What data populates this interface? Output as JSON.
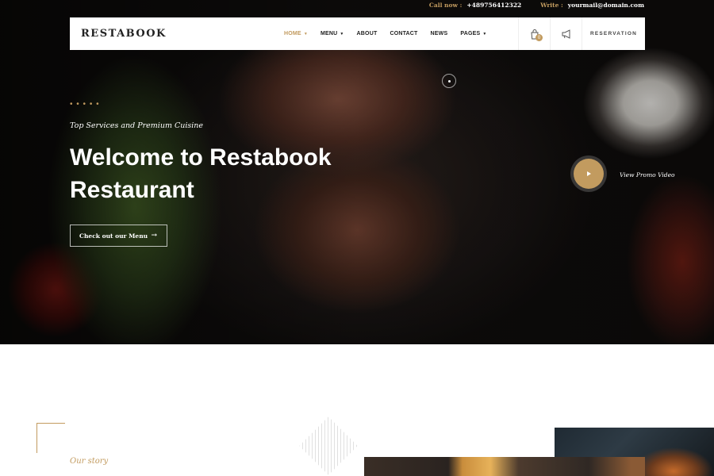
{
  "topbar": {
    "call_label": "Call now :",
    "phone": "+489756412322",
    "write_label": "Write :",
    "email": "yourmail@domain.com"
  },
  "nav": {
    "logo": "RESTABOOK",
    "items": [
      {
        "label": "HOME",
        "active": true,
        "dropdown": true
      },
      {
        "label": "MENU",
        "active": false,
        "dropdown": true
      },
      {
        "label": "ABOUT",
        "active": false,
        "dropdown": false
      },
      {
        "label": "CONTACT",
        "active": false,
        "dropdown": false
      },
      {
        "label": "NEWS",
        "active": false,
        "dropdown": false
      },
      {
        "label": "PAGES",
        "active": false,
        "dropdown": true
      }
    ],
    "cart_count": "0",
    "reservation_label": "RESERVATION"
  },
  "hero": {
    "subtitle": "Top Services and Premium Cuisine",
    "headline": "Welcome to Restabook Restaurant",
    "menu_button": "Check out our Menu",
    "promo_label": "View Promo Video"
  },
  "story": {
    "label": "Our story"
  },
  "colors": {
    "accent": "#c29b5f",
    "nav_bg": "#ffffff",
    "text_dark": "#222222"
  }
}
